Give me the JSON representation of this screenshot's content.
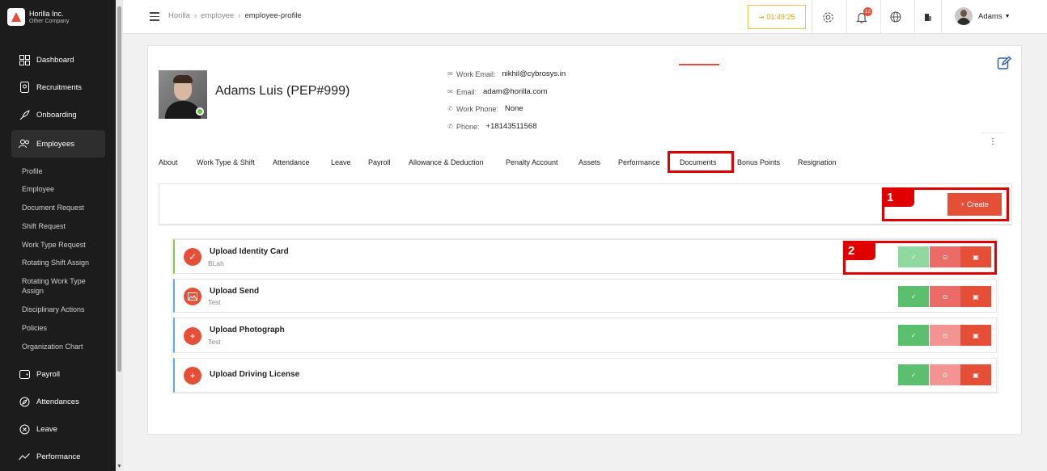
{
  "company": {
    "name": "Horilla Inc.",
    "sub": "Other Company"
  },
  "sidebar": {
    "items": [
      {
        "label": "Dashboard",
        "icon": "dashboard-icon"
      },
      {
        "label": "Recruitments",
        "icon": "recruitment-icon"
      },
      {
        "label": "Onboarding",
        "icon": "rocket-icon"
      },
      {
        "label": "Employees",
        "icon": "people-icon"
      },
      {
        "label": "Payroll",
        "icon": "wallet-icon"
      },
      {
        "label": "Attendances",
        "icon": "compass-icon"
      },
      {
        "label": "Leave",
        "icon": "close-circle-icon"
      },
      {
        "label": "Performance",
        "icon": "trend-icon"
      }
    ],
    "sub_items": [
      "Profile",
      "Employee",
      "Document Request",
      "Shift Request",
      "Work Type Request",
      "Rotating Shift Assign",
      "Rotating Work Type Assign",
      "Disciplinary Actions",
      "Policies",
      "Organization Chart"
    ]
  },
  "topbar": {
    "breadcrumbs": [
      "Horilla",
      "employee",
      "employee-profile"
    ],
    "timer": "01:49:25",
    "notifications": "12",
    "user": "Adams"
  },
  "profile": {
    "name": "Adams Luis (PEP#999)",
    "work_email_label": "Work Email:",
    "work_email": "nikhil@cybrosys.in",
    "email_label": "Email:",
    "email": "adam@horilla.com",
    "work_phone_label": "Work Phone:",
    "work_phone": "None",
    "phone_label": "Phone:",
    "phone": "+18143511568"
  },
  "tabs": [
    "About",
    "Work Type & Shift",
    "Attendance",
    "Leave",
    "Payroll",
    "Allowance & Deduction",
    "Penalty Account",
    "Assets",
    "Performance",
    "Documents",
    "Bonus Points",
    "Resignation"
  ],
  "create_label": "+ Create",
  "documents": [
    {
      "title": "Upload Identity Card",
      "sub": "BLah",
      "icon": "check-icon"
    },
    {
      "title": "Upload Send",
      "sub": "Test",
      "icon": "image-icon"
    },
    {
      "title": "Upload Photograph",
      "sub": "Test",
      "icon": "plus-icon"
    },
    {
      "title": "Upload Driving License",
      "sub": "",
      "icon": "plus-icon"
    }
  ],
  "callouts": [
    "1",
    "2"
  ],
  "colors": {
    "accent": "#e54f38",
    "sidebar": "#1c1c1c",
    "highlight": "#e00000",
    "approve": "#5bbf6d"
  }
}
